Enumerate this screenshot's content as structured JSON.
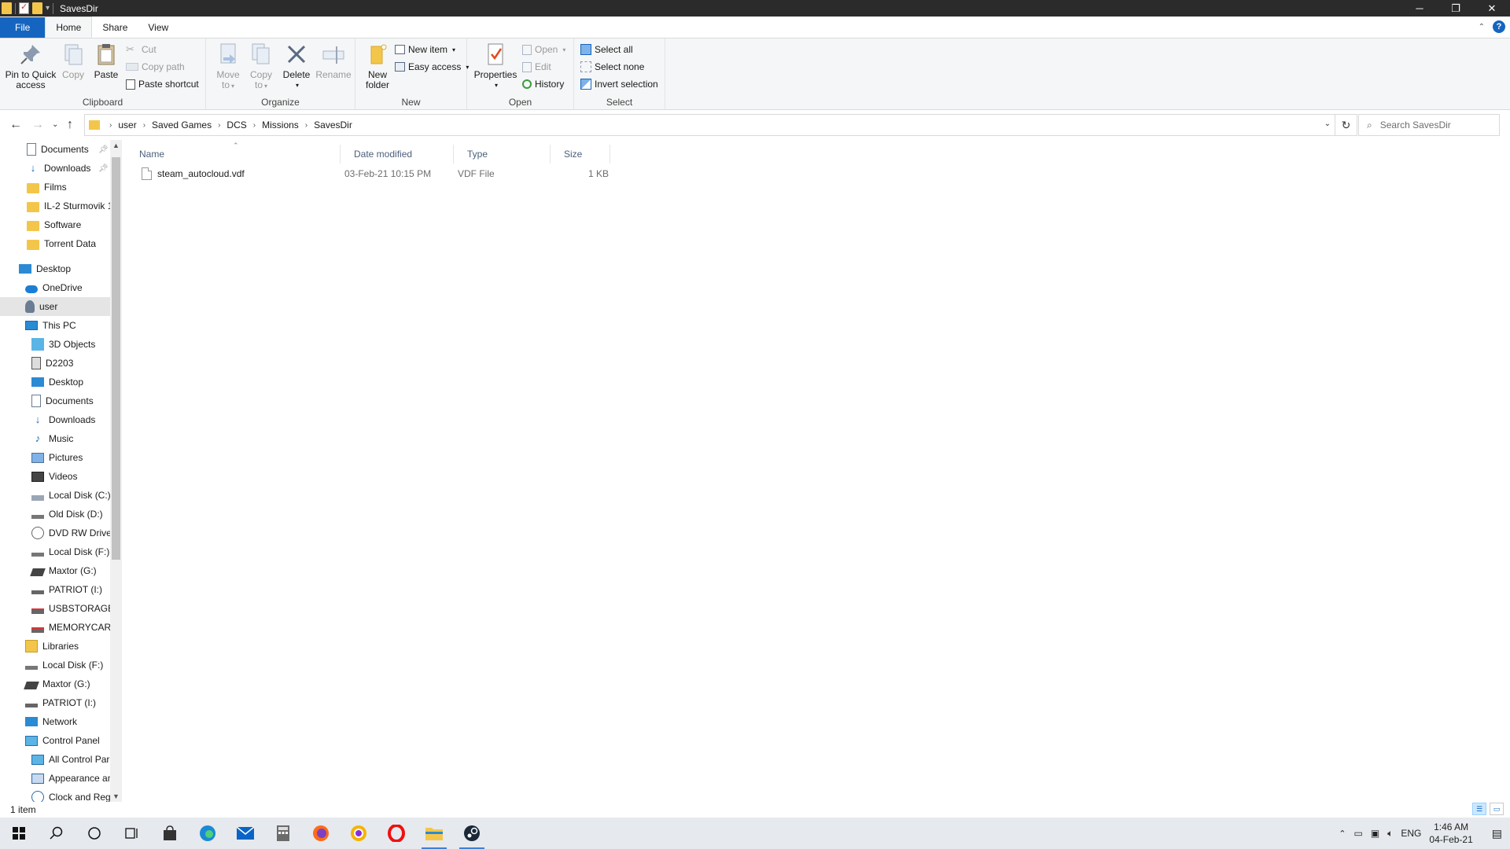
{
  "window": {
    "title": "SavesDir"
  },
  "ribbon_tabs": [
    {
      "label": "File"
    },
    {
      "label": "Home"
    },
    {
      "label": "Share"
    },
    {
      "label": "View"
    }
  ],
  "ribbon": {
    "clipboard": {
      "group_label": "Clipboard",
      "pin_label_1": "Pin to Quick",
      "pin_label_2": "access",
      "copy_label": "Copy",
      "paste_label": "Paste",
      "cut_label": "Cut",
      "copy_path_label": "Copy path",
      "paste_shortcut_label": "Paste shortcut"
    },
    "organize": {
      "group_label": "Organize",
      "move_label_1": "Move",
      "move_label_2": "to",
      "copyto_label_1": "Copy",
      "copyto_label_2": "to",
      "delete_label": "Delete",
      "rename_label": "Rename"
    },
    "new": {
      "group_label": "New",
      "new_folder_label_1": "New",
      "new_folder_label_2": "folder",
      "new_item_label": "New item",
      "easy_access_label": "Easy access"
    },
    "open": {
      "group_label": "Open",
      "properties_label": "Properties",
      "open_label": "Open",
      "edit_label": "Edit",
      "history_label": "History"
    },
    "select": {
      "group_label": "Select",
      "select_all_label": "Select all",
      "select_none_label": "Select none",
      "invert_label": "Invert selection"
    }
  },
  "breadcrumb": [
    "user",
    "Saved Games",
    "DCS",
    "Missions",
    "SavesDir"
  ],
  "search": {
    "placeholder": "Search SavesDir"
  },
  "nav": {
    "quick_access": [
      {
        "label": "Documents",
        "icon": "documents-icon",
        "pinned": true
      },
      {
        "label": "Downloads",
        "icon": "downloads-icon",
        "pinned": true
      },
      {
        "label": "Films",
        "icon": "folder-icon"
      },
      {
        "label": "IL-2 Sturmovik 1",
        "icon": "folder-icon"
      },
      {
        "label": "Software",
        "icon": "folder-icon"
      },
      {
        "label": "Torrent Data",
        "icon": "folder-icon"
      }
    ],
    "tree": [
      {
        "label": "Desktop",
        "icon": "desktop-icon",
        "indent": 0
      },
      {
        "label": "OneDrive",
        "icon": "onedrive-icon",
        "indent": 1
      },
      {
        "label": "user",
        "icon": "user-icon",
        "indent": 1,
        "selected": true
      },
      {
        "label": "This PC",
        "icon": "this-pc-icon",
        "indent": 1
      },
      {
        "label": "3D Objects",
        "icon": "3d-objects-icon",
        "indent": 2
      },
      {
        "label": "D2203",
        "icon": "device-icon",
        "indent": 2
      },
      {
        "label": "Desktop",
        "icon": "desktop-icon",
        "indent": 2
      },
      {
        "label": "Documents",
        "icon": "documents-icon",
        "indent": 2
      },
      {
        "label": "Downloads",
        "icon": "downloads-icon",
        "indent": 2
      },
      {
        "label": "Music",
        "icon": "music-icon",
        "indent": 2
      },
      {
        "label": "Pictures",
        "icon": "pictures-icon",
        "indent": 2
      },
      {
        "label": "Videos",
        "icon": "videos-icon",
        "indent": 2
      },
      {
        "label": "Local Disk (C:)",
        "icon": "system-drive-icon",
        "indent": 2
      },
      {
        "label": "Old Disk (D:)",
        "icon": "drive-icon",
        "indent": 2
      },
      {
        "label": "DVD RW Drive",
        "icon": "dvd-icon",
        "indent": 2
      },
      {
        "label": "Local Disk (F:)",
        "icon": "drive-icon",
        "indent": 2
      },
      {
        "label": "Maxtor (G:)",
        "icon": "removable-drive-icon",
        "indent": 2
      },
      {
        "label": "PATRIOT (I:)",
        "icon": "usb-drive-icon",
        "indent": 2
      },
      {
        "label": "USBSTORAGE (",
        "icon": "usb-storage-icon",
        "indent": 2
      },
      {
        "label": "MEMORYCARD",
        "icon": "memory-card-icon",
        "indent": 2
      },
      {
        "label": "Libraries",
        "icon": "libraries-icon",
        "indent": 1
      },
      {
        "label": "Local Disk (F:)",
        "icon": "drive-icon",
        "indent": 1
      },
      {
        "label": "Maxtor (G:)",
        "icon": "removable-drive-icon",
        "indent": 1
      },
      {
        "label": "PATRIOT (I:)",
        "icon": "usb-drive-icon",
        "indent": 1
      },
      {
        "label": "Network",
        "icon": "network-icon",
        "indent": 1
      },
      {
        "label": "Control Panel",
        "icon": "control-panel-icon",
        "indent": 1
      },
      {
        "label": "All Control Par",
        "icon": "control-panel-icon",
        "indent": 2
      },
      {
        "label": "Appearance an",
        "icon": "appearance-icon",
        "indent": 2
      },
      {
        "label": "Clock and Regi",
        "icon": "clock-icon",
        "indent": 2
      }
    ]
  },
  "columns": {
    "name": "Name",
    "date": "Date modified",
    "type": "Type",
    "size": "Size"
  },
  "files": [
    {
      "name": "steam_autocloud.vdf",
      "date": "03-Feb-21 10:15 PM",
      "type": "VDF File",
      "size": "1 KB"
    }
  ],
  "status": {
    "item_count": "1 item"
  },
  "tray": {
    "language": "ENG",
    "time": "1:46 AM",
    "date": "04-Feb-21"
  },
  "colors": {
    "accent": "#1565c0",
    "titlebar": "#2b2b2b",
    "selected": "#e5e5e5",
    "folder": "#f3c64b"
  }
}
